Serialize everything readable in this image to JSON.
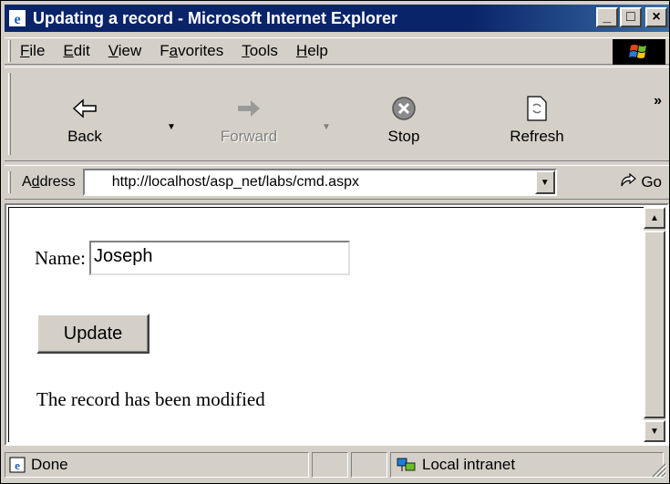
{
  "window": {
    "title": "Updating a record - Microsoft Internet Explorer",
    "controls": {
      "minimize": "_",
      "maximize": "□",
      "close": "×"
    }
  },
  "menu": {
    "items": [
      {
        "label": "File",
        "accel": "F",
        "rest": "ile"
      },
      {
        "label": "Edit",
        "accel": "E",
        "rest": "dit"
      },
      {
        "label": "View",
        "accel": "V",
        "rest": "iew"
      },
      {
        "label": "Favorites",
        "pre": "F",
        "accel": "a",
        "rest": "vorites"
      },
      {
        "label": "Tools",
        "accel": "T",
        "rest": "ools"
      },
      {
        "label": "Help",
        "accel": "H",
        "rest": "elp"
      }
    ]
  },
  "toolbar": {
    "back": "Back",
    "forward": "Forward",
    "stop": "Stop",
    "refresh": "Refresh",
    "more": "»"
  },
  "address": {
    "label_pre": "A",
    "label_accel": "d",
    "label_rest": "dress",
    "url": "http://localhost/asp_net/labs/cmd.aspx",
    "go": "Go"
  },
  "page": {
    "name_label": "Name:",
    "name_value": "Joseph",
    "update_button": "Update",
    "message": "The record has been modified"
  },
  "status": {
    "text": "Done",
    "zone": "Local intranet"
  },
  "colors": {
    "titlebar": "#0a246a",
    "chrome": "#d4d0c8"
  }
}
